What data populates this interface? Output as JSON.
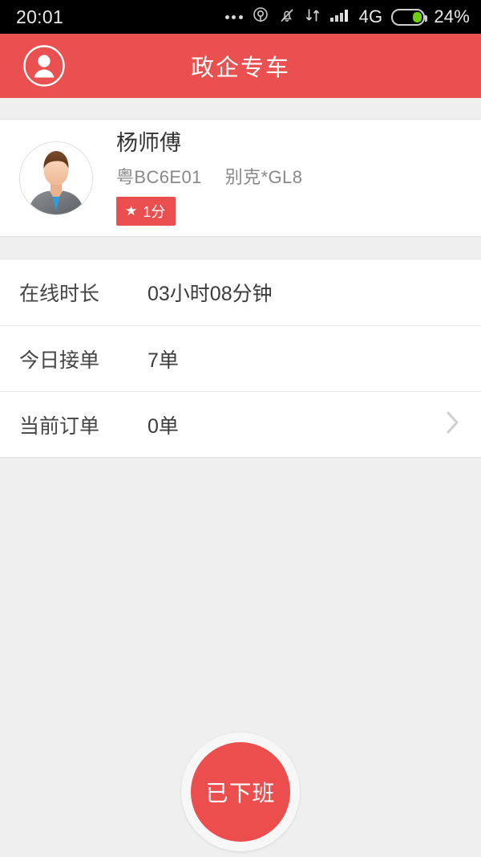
{
  "statusbar": {
    "time": "20:01",
    "network": "4G",
    "battery_percent": "24%",
    "icons": [
      "more-dots-icon",
      "location-icon",
      "mute-bell-icon",
      "data-transfer-icon",
      "signal-bars-icon",
      "battery-icon"
    ]
  },
  "header": {
    "title": "政企专车",
    "avatar_icon": "user-circle-icon",
    "background_color": "#e9504f"
  },
  "profile": {
    "avatar_icon": "driver-avatar",
    "name": "杨师傅",
    "plate": "粤BC6E01",
    "vehicle": "别克*GL8",
    "rating_badge": {
      "star_icon": "star-icon",
      "text": "1分",
      "color": "#ea4e4e"
    }
  },
  "stats": {
    "rows": [
      {
        "label": "在线时长",
        "value": "03小时08分钟",
        "has_chevron": false
      },
      {
        "label": "今日接单",
        "value": "7单",
        "has_chevron": false
      },
      {
        "label": "当前订单",
        "value": "0单",
        "has_chevron": true
      }
    ]
  },
  "duty": {
    "button_label": "已下班",
    "color": "#ec4e4e"
  }
}
